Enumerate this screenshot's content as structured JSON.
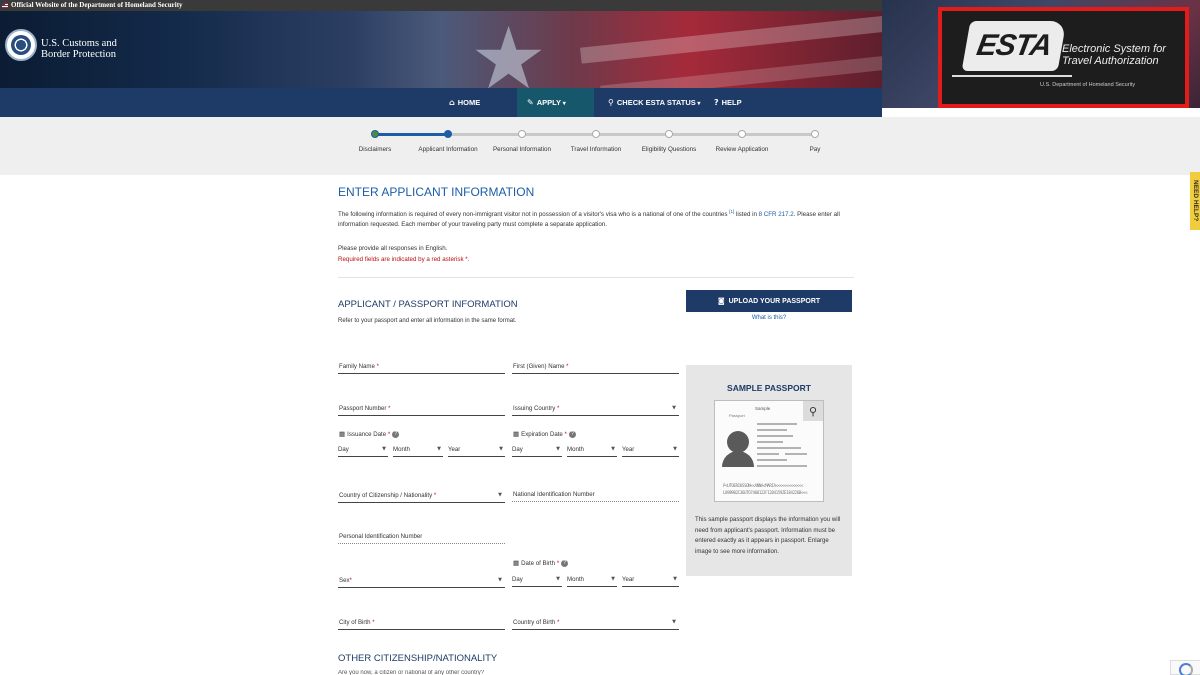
{
  "gov_bar": {
    "text": "Official Website of the Department of Homeland Security"
  },
  "agency": {
    "line1": "U.S. Customs and",
    "line2": "Border Protection"
  },
  "esta_logo": {
    "word": "ESTA",
    "line1": "Electronic System for",
    "line2": "Travel Authorization",
    "dhs": "U.S. Department of Homeland Security"
  },
  "nav": [
    {
      "label": "HOME",
      "icon": "home-icon"
    },
    {
      "label": "APPLY",
      "icon": "pencil-icon",
      "active": true
    },
    {
      "label": "CHECK ESTA STATUS",
      "icon": "search-icon"
    },
    {
      "label": "HELP",
      "icon": "help-circle-icon"
    }
  ],
  "progress": {
    "current_step": 2,
    "steps": [
      "Disclaimers",
      "Applicant Information",
      "Personal Information",
      "Travel Information",
      "Eligibility Questions",
      "Review Application",
      "Pay"
    ]
  },
  "need_help": "NEED HELP?",
  "page": {
    "title": "ENTER APPLICANT INFORMATION",
    "intro_a": "The following information is required of every non-immigrant visitor not in possession of a visitor's visa who is a national of one of the countries",
    "intro_sup": "[1]",
    "intro_b": " listed in ",
    "intro_link": "8 CFR 217.2",
    "intro_c": ". Please enter all information requested. Each member of your traveling party must complete a separate application.",
    "english": "Please provide all responses in English.",
    "required_note": "Required fields are indicated by a red asterisk *."
  },
  "section": {
    "title": "APPLICANT / PASSPORT INFORMATION",
    "note": "Refer to your passport and enter all information in the same format.",
    "other_title": "OTHER CITIZENSHIP/NATIONALITY",
    "other_cut": "Are you now, a citizen or national of any other country?"
  },
  "upload": {
    "label": "UPLOAD YOUR PASSPORT",
    "help": "What is this?"
  },
  "fields": {
    "family_name": "Family Name",
    "first_name": "First (Given) Name",
    "passport_number": "Passport Number",
    "issuing_country": "Issuing Country",
    "issuance_date": "Issuance Date",
    "expiration_date": "Expiration Date",
    "citizenship": "Country of Citizenship / Nationality",
    "national_id": "National Identification Number",
    "personal_id": "Personal Identification Number",
    "date_of_birth": "Date of Birth",
    "sex": "Sex",
    "city_of_birth": "City of Birth",
    "country_of_birth": "Country of Birth",
    "day": "Day",
    "month": "Month",
    "year": "Year",
    "asterisk": "*"
  },
  "sample": {
    "title": "SAMPLE PASSPORT",
    "text": "This sample passport displays the information you will need from applicant's passport. Information must be entered exactly as it appears in passport. Enlarge image to see more information.",
    "pp_word": "Sample",
    "pp_passport": "Passport",
    "mrz1": "P<UTOERIKSSON<<ANNA<MARIA<<<<<<<<<<<<<",
    "mrz2": "L898902C36UTO7408122F1204159ZE184226B<<<"
  },
  "colors": {
    "nav_bg": "#1d3b66",
    "accent": "#1d5da8",
    "required": "#c81010",
    "esta_frame": "#e41b1b"
  }
}
